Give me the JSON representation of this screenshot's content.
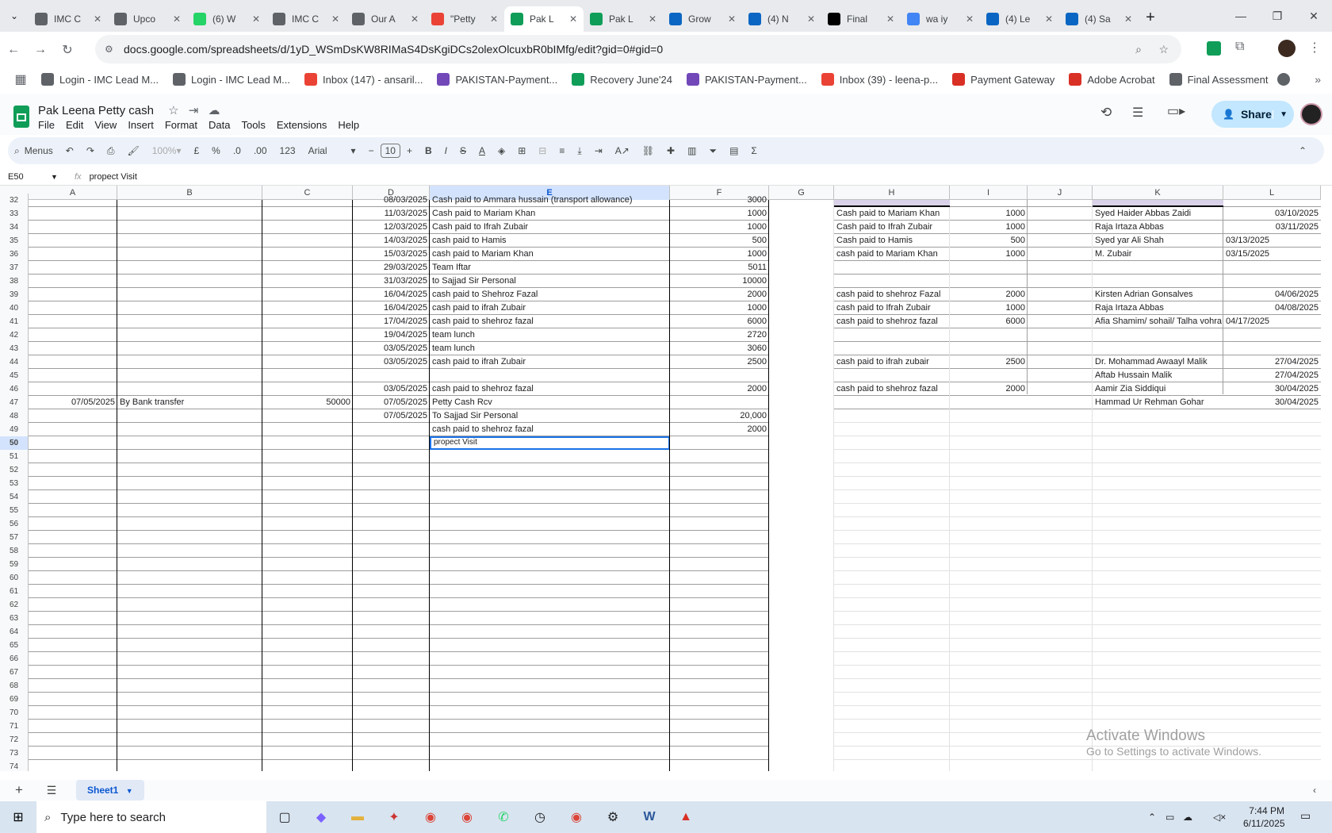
{
  "browser": {
    "tabs": [
      {
        "label": "IMC C",
        "icon": "gem-icon",
        "color": "#5f6368"
      },
      {
        "label": "Upco",
        "icon": "gem-icon",
        "color": "#5f6368"
      },
      {
        "label": "(6) W",
        "icon": "whatsapp-icon",
        "color": "#25d366"
      },
      {
        "label": "IMC C",
        "icon": "gem-icon",
        "color": "#5f6368"
      },
      {
        "label": "Our A",
        "icon": "gem-icon",
        "color": "#5f6368"
      },
      {
        "label": "\"Petty",
        "icon": "gmail-icon",
        "color": "#ea4335"
      },
      {
        "label": "Pak L",
        "icon": "sheets-icon",
        "color": "#0f9d58",
        "active": true
      },
      {
        "label": "Pak L",
        "icon": "sheets-icon",
        "color": "#0f9d58"
      },
      {
        "label": "Grow",
        "icon": "linkedin-icon",
        "color": "#0a66c2"
      },
      {
        "label": "(4) N",
        "icon": "linkedin-icon",
        "color": "#0a66c2"
      },
      {
        "label": "Final",
        "icon": "github-icon",
        "color": "#000000"
      },
      {
        "label": "wa iy",
        "icon": "google-icon",
        "color": "#4285f4"
      },
      {
        "label": "(4) Le",
        "icon": "linkedin-icon",
        "color": "#0a66c2"
      },
      {
        "label": "(4) Sa",
        "icon": "linkedin-icon",
        "color": "#0a66c2"
      }
    ],
    "url": "docs.google.com/spreadsheets/d/1yD_WSmDsKW8RIMaS4DsKgiDCs2olexOlcuxbR0bIMfg/edit?gid=0#gid=0",
    "bookmarks": [
      {
        "label": "Login - IMC Lead M...",
        "icon": "gem-icon",
        "color": "#5f6368"
      },
      {
        "label": "Login - IMC Lead M...",
        "icon": "gem-icon",
        "color": "#5f6368"
      },
      {
        "label": "Inbox (147) - ansaril...",
        "icon": "gmail-icon",
        "color": "#ea4335"
      },
      {
        "label": "PAKISTAN-Payment...",
        "icon": "forms-icon",
        "color": "#7248b9"
      },
      {
        "label": "Recovery June'24",
        "icon": "sheets-icon",
        "color": "#0f9d58"
      },
      {
        "label": "PAKISTAN-Payment...",
        "icon": "forms-icon",
        "color": "#7248b9"
      },
      {
        "label": "Inbox (39) - leena-p...",
        "icon": "gmail-icon",
        "color": "#ea4335"
      },
      {
        "label": "Payment Gateway",
        "icon": "triangle-icon",
        "color": "#d93025"
      },
      {
        "label": "Adobe Acrobat",
        "icon": "acrobat-icon",
        "color": "#d93025"
      },
      {
        "label": "Final Assessment",
        "icon": "gem-icon",
        "color": "#5f6368"
      }
    ]
  },
  "doc": {
    "title": "Pak Leena Petty cash",
    "menus": [
      "File",
      "Edit",
      "View",
      "Insert",
      "Format",
      "Data",
      "Tools",
      "Extensions",
      "Help"
    ],
    "share": "Share"
  },
  "toolbar": {
    "menus": "Menus",
    "zoom": "100%",
    "currency": "£",
    "percent": "%",
    "dec_minus": ".0",
    "dec_plus": ".00",
    "numfmt": "123",
    "font": "Arial",
    "size": "10"
  },
  "formula": {
    "ref": "E50",
    "value": "propect Visit"
  },
  "columns": [
    "A",
    "B",
    "C",
    "D",
    "E",
    "F",
    "G",
    "H",
    "I",
    "J",
    "K",
    "L"
  ],
  "rows": [
    {
      "n": "32",
      "d": "08/03/2025",
      "e": "Cash paid to Ammara hussain (transport allowance)",
      "f": "3000"
    },
    {
      "n": "33",
      "d": "11/03/2025",
      "e": "Cash paid to Mariam Khan",
      "f": "1000",
      "h": "Cash paid to Mariam Khan",
      "i": "1000",
      "k": "Syed Haider Abbas Zaidi",
      "l": "03/10/2025"
    },
    {
      "n": "34",
      "d": "12/03/2025",
      "e": "Cash paid to Ifrah Zubair",
      "f": "1000",
      "h": "Cash paid to Ifrah Zubair",
      "i": "1000",
      "k": "Raja Irtaza Abbas",
      "l": "03/11/2025"
    },
    {
      "n": "35",
      "d": "14/03/2025",
      "e": "cash paid to Hamis",
      "f": "500",
      "h": "Cash paid to Hamis",
      "i": "500",
      "k": "Syed yar Ali Shah",
      "l": "03/13/2025",
      "lLeft": true
    },
    {
      "n": "36",
      "d": "15/03/2025",
      "e": "cash paid to Mariam Khan",
      "f": "1000",
      "h": "cash paid to Mariam Khan",
      "i": "1000",
      "k": "M. Zubair",
      "l": "03/15/2025",
      "lLeft": true
    },
    {
      "n": "37",
      "d": "29/03/2025",
      "e": "Team Iftar",
      "f": "5011"
    },
    {
      "n": "38",
      "d": "31/03/2025",
      "e": "to Sajjad Sir Personal",
      "f": "10000"
    },
    {
      "n": "39",
      "d": "16/04/2025",
      "e": "cash paid to Shehroz Fazal",
      "f": "2000",
      "h": "cash paid to shehroz Fazal",
      "i": "2000",
      "k": "Kirsten Adrian Gonsalves",
      "l": "04/06/2025"
    },
    {
      "n": "40",
      "d": "16/04/2025",
      "e": "cash paid to ifrah Zubair",
      "f": "1000",
      "h": "cash paid to Ifrah Zubair",
      "i": "1000",
      "k": "Raja Irtaza Abbas",
      "l": "04/08/2025"
    },
    {
      "n": "41",
      "d": "17/04/2025",
      "e": "cash paid to shehroz fazal",
      "f": "6000",
      "h": "cash paid to shehroz fazal",
      "i": "6000",
      "k": "Afia Shamim/ sohail/ Talha vohra",
      "l": "04/17/2025",
      "lLeft": true
    },
    {
      "n": "42",
      "d": "19/04/2025",
      "e": "team lunch",
      "f": "2720"
    },
    {
      "n": "43",
      "d": "03/05/2025",
      "e": "team lunch",
      "f": "3060"
    },
    {
      "n": "44",
      "d": "03/05/2025",
      "e": "cash paid to ifrah Zubair",
      "f": "2500",
      "h": "cash paid to ifrah zubair",
      "i": "2500",
      "k": " Dr. Mohammad Awaayl Malik",
      "l": "27/04/2025"
    },
    {
      "n": "45",
      "k": "Aftab Hussain Malik",
      "l": "27/04/2025"
    },
    {
      "n": "46",
      "d": "03/05/2025",
      "e": "cash paid to shehroz fazal",
      "f": "2000",
      "h": "cash paid to shehroz fazal",
      "i": "2000",
      "k": "Aamir Zia Siddiqui",
      "l": "30/04/2025"
    },
    {
      "n": "47",
      "a": "07/05/2025",
      "b": "By Bank transfer",
      "c": "50000",
      "d": "07/05/2025",
      "e": "Petty Cash  Rcv",
      "k": "Hammad Ur Rehman Gohar",
      "l": "30/04/2025"
    },
    {
      "n": "48",
      "d": "07/05/2025",
      "e": "To Sajjad Sir Personal",
      "f": "20,000"
    },
    {
      "n": "49",
      "e": "cash paid to shehroz fazal",
      "f": "2000"
    },
    {
      "n": "50",
      "e": "propect Visit",
      "editing": true
    },
    {
      "n": "51"
    },
    {
      "n": "52"
    },
    {
      "n": "53"
    },
    {
      "n": "54"
    },
    {
      "n": "55"
    },
    {
      "n": "56"
    },
    {
      "n": "57"
    },
    {
      "n": "58"
    },
    {
      "n": "59"
    },
    {
      "n": "60"
    },
    {
      "n": "61"
    },
    {
      "n": "62"
    },
    {
      "n": "63"
    },
    {
      "n": "64"
    },
    {
      "n": "65"
    },
    {
      "n": "66"
    },
    {
      "n": "67"
    },
    {
      "n": "68"
    },
    {
      "n": "69"
    },
    {
      "n": "70"
    },
    {
      "n": "71"
    },
    {
      "n": "72"
    },
    {
      "n": "73"
    },
    {
      "n": "74"
    }
  ],
  "sheet_tab": "Sheet1",
  "watermark": {
    "line1": "Activate Windows",
    "line2": "Go to Settings to activate Windows."
  },
  "taskbar": {
    "search": "Type here to search",
    "time": "7:44 PM",
    "date": "6/11/2025"
  }
}
